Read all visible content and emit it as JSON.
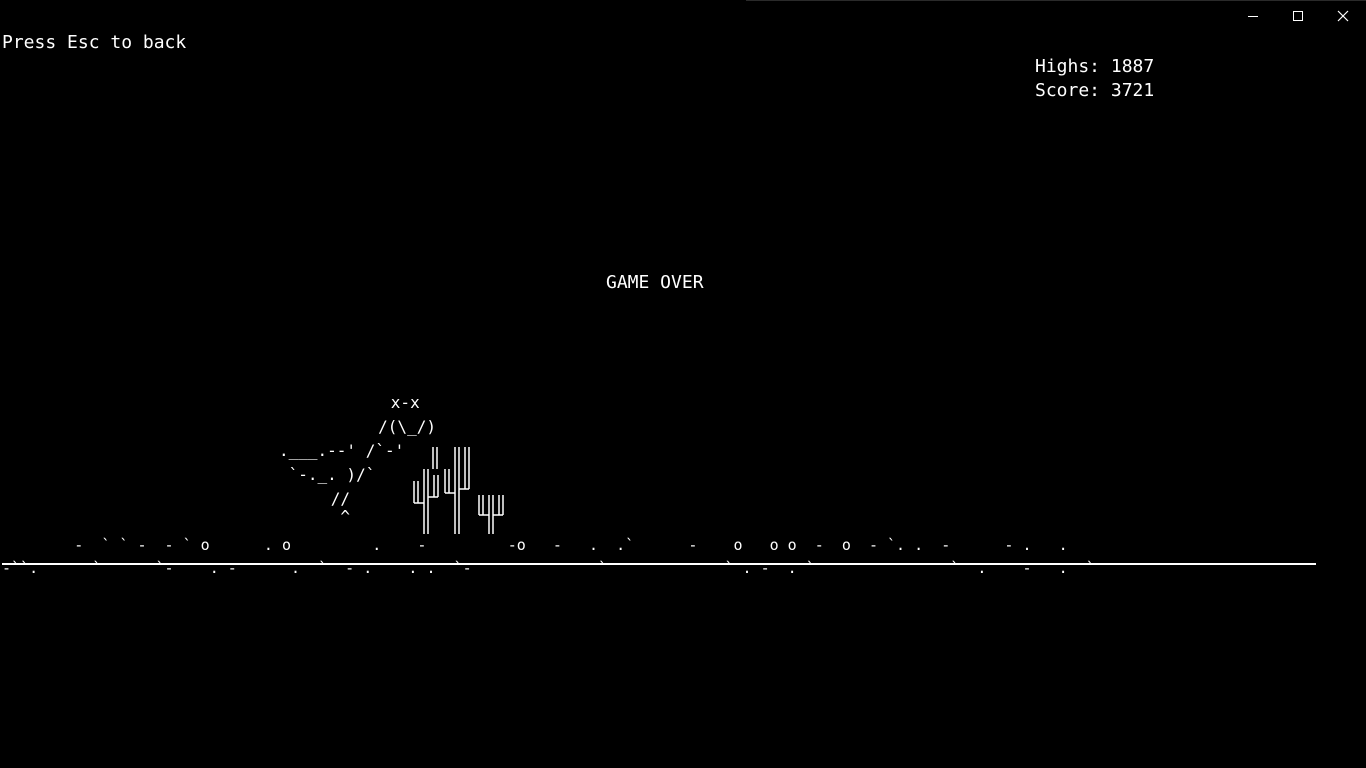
{
  "window": {
    "controls": [
      "minimize-icon",
      "maximize-icon",
      "close-icon"
    ]
  },
  "hud": {
    "back_hint": "Press Esc to back",
    "highs_label": "Highs: 1887",
    "score_label": "Score: 3721",
    "game_over": "GAME OVER"
  },
  "dino": {
    "lines": [
      "      x-x",
      "     /(\\_/)",
      ".___.--' /`-'",
      " `-._. )/`",
      "      //",
      "       ^"
    ]
  },
  "cacti": {
    "count": 3
  },
  "ground": {
    "row1": "        -  ` ` -  - ` o      . o         .    -         -o   -   .  .`      -    o   o o  -  o  - `. .  -      - .   .",
    "row2": "-``.      `      `-    . -      .  `  - .    . .  `-              `             ` . -  . `               `  .    -   .  `"
  },
  "colors": {
    "background": "#000000",
    "foreground": "#ffffff"
  }
}
